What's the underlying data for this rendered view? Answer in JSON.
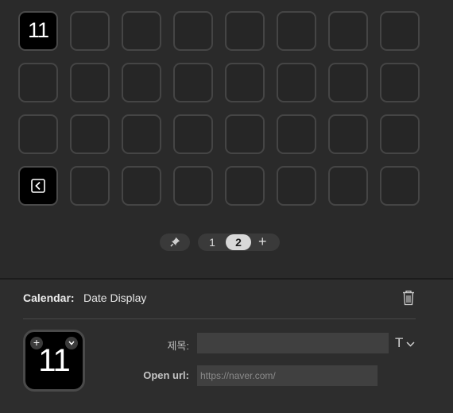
{
  "grid": {
    "rows": 4,
    "cols": 8,
    "keys": [
      {
        "row": 0,
        "col": 0,
        "type": "calendar",
        "text": "11",
        "selected": true
      },
      {
        "row": 3,
        "col": 0,
        "type": "back",
        "icon": "back-arrow-icon"
      }
    ]
  },
  "pager": {
    "pin_icon": "pin-icon",
    "pages": [
      "1",
      "2"
    ],
    "active_page": "2",
    "add_label": "+"
  },
  "inspector": {
    "plugin_label": "Calendar:",
    "action_name": "Date Display",
    "trash_icon": "trash-icon",
    "preview": {
      "text": "11",
      "plus_label": "+",
      "chevron_icon": "chevron-down-icon"
    },
    "title_label": "제목:",
    "title_value": "",
    "text_style_label": "T",
    "url_label": "Open url:",
    "url_placeholder": "https://naver.com/"
  },
  "colors": {
    "background": "#2a2a2a",
    "selected_border": "#1f7ae0",
    "key_border": "#454545"
  }
}
